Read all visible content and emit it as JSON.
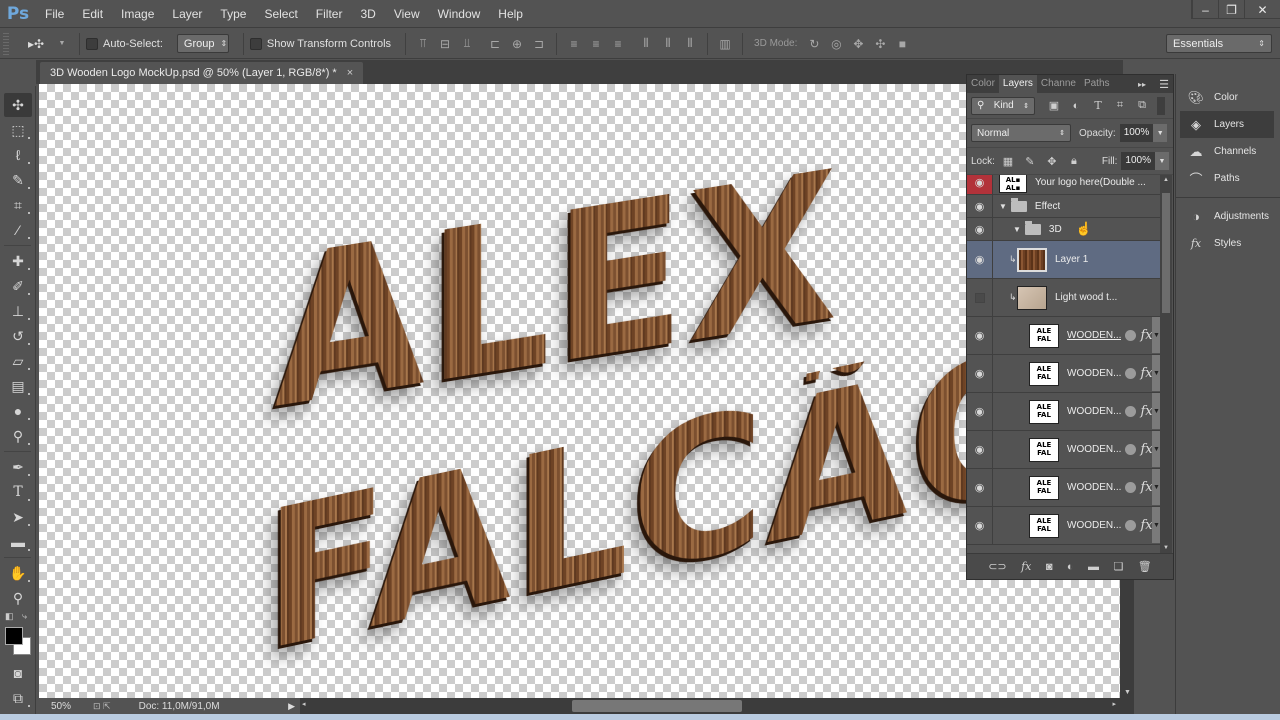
{
  "app": {
    "logo": "Ps",
    "menu": [
      "File",
      "Edit",
      "Image",
      "Layer",
      "Type",
      "Select",
      "Filter",
      "3D",
      "View",
      "Window",
      "Help"
    ],
    "window_controls": {
      "minimize": "‒",
      "restore": "❐",
      "close": "✕"
    }
  },
  "options_bar": {
    "auto_select_label": "Auto-Select:",
    "auto_select_checked": false,
    "auto_select_target": "Group",
    "show_transform_label": "Show Transform Controls",
    "show_transform_checked": false,
    "mode_3d_label": "3D Mode:",
    "workspace": "Essentials"
  },
  "document": {
    "tab_title": "3D Wooden Logo MockUp.psd @ 50% (Layer 1, RGB/8*) *",
    "close_icon": "×",
    "canvas_text_line1": "ALEX",
    "canvas_text_line2": "FALCÃO"
  },
  "status": {
    "zoom": "50%",
    "doc_size": "Doc: 11,0M/91,0M"
  },
  "tools": [
    "move-tool",
    "marquee-tool",
    "lasso-tool",
    "quick-selection-tool",
    "crop-tool",
    "eyedropper-tool",
    "healing-brush-tool",
    "brush-tool",
    "clone-stamp-tool",
    "history-brush-tool",
    "eraser-tool",
    "gradient-tool",
    "blur-tool",
    "dodge-tool",
    "pen-tool",
    "type-tool",
    "path-selection-tool",
    "rectangle-tool",
    "hand-tool",
    "zoom-tool"
  ],
  "layers_panel": {
    "tabs": [
      "Color",
      "Layers",
      "Channe",
      "Paths"
    ],
    "active_tab": "Layers",
    "filter_kind": "Kind",
    "blend_mode": "Normal",
    "opacity_label": "Opacity:",
    "opacity": "100%",
    "lock_label": "Lock:",
    "fill_label": "Fill:",
    "fill": "100%",
    "layers": [
      {
        "name": "Your logo here(Double ...",
        "type": "smart-object",
        "visible": true,
        "highlight": "red"
      },
      {
        "name": "Effect",
        "type": "group",
        "visible": true,
        "expanded": true,
        "indent": 0
      },
      {
        "name": "3D",
        "type": "group",
        "visible": true,
        "expanded": true,
        "indent": 1
      },
      {
        "name": "Layer 1",
        "type": "pixel",
        "visible": true,
        "selected": true,
        "clipped": true
      },
      {
        "name": "Light wood t...",
        "type": "pixel",
        "visible": false,
        "clipped": true
      },
      {
        "name": "WOODEN...",
        "type": "smart-object",
        "visible": true,
        "fx": true
      },
      {
        "name": "WOODEN...",
        "type": "smart-object",
        "visible": true,
        "fx": true
      },
      {
        "name": "WOODEN...",
        "type": "smart-object",
        "visible": true,
        "fx": true
      },
      {
        "name": "WOODEN...",
        "type": "smart-object",
        "visible": true,
        "fx": true
      },
      {
        "name": "WOODEN...",
        "type": "smart-object",
        "visible": true,
        "fx": true
      },
      {
        "name": "WOODEN...",
        "type": "smart-object",
        "visible": true,
        "fx": true
      }
    ],
    "fx_label": "fx"
  },
  "dock": {
    "group1": [
      "Color",
      "Layers",
      "Channels",
      "Paths"
    ],
    "group2": [
      "Adjustments",
      "Styles"
    ],
    "active": "Layers"
  }
}
